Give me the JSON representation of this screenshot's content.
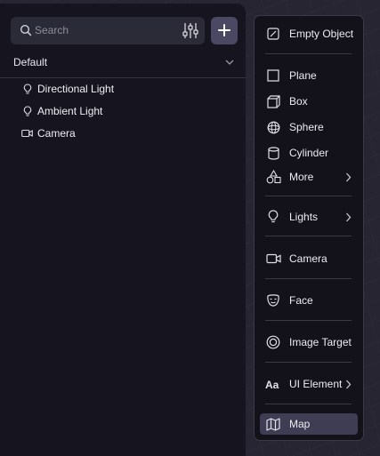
{
  "colors": {
    "panel_bg": "#16151f",
    "menu_bg": "#13121b",
    "accent_button": "#4a4862",
    "selected_item": "#3e3d54",
    "text": "#ececf2",
    "muted_text": "#8d8c9a"
  },
  "search": {
    "placeholder": "Search",
    "icon": "search-icon",
    "filter_icon": "sliders-icon"
  },
  "add_button": {
    "icon": "plus-icon"
  },
  "scene": {
    "title": "Default",
    "items": [
      {
        "label": "Directional Light",
        "icon": "lightbulb-icon"
      },
      {
        "label": "Ambient Light",
        "icon": "lightbulb-icon"
      },
      {
        "label": "Camera",
        "icon": "video-camera-icon"
      }
    ]
  },
  "menu": {
    "items": [
      {
        "label": "Empty Object",
        "icon": "empty-object-icon"
      },
      {
        "label": "Plane",
        "icon": "plane-icon"
      },
      {
        "label": "Box",
        "icon": "box-icon"
      },
      {
        "label": "Sphere",
        "icon": "sphere-icon"
      },
      {
        "label": "Cylinder",
        "icon": "cylinder-icon"
      },
      {
        "label": "More",
        "icon": "shapes-icon",
        "has_submenu": true
      },
      {
        "label": "Lights",
        "icon": "lightbulb-icon",
        "has_submenu": true
      },
      {
        "label": "Camera",
        "icon": "video-camera-icon"
      },
      {
        "label": "Face",
        "icon": "face-icon"
      },
      {
        "label": "Image Target",
        "icon": "target-icon"
      },
      {
        "label": "UI Element",
        "icon": "text-aa-icon",
        "has_submenu": true
      },
      {
        "label": "Map",
        "icon": "map-icon",
        "selected": true
      }
    ]
  }
}
